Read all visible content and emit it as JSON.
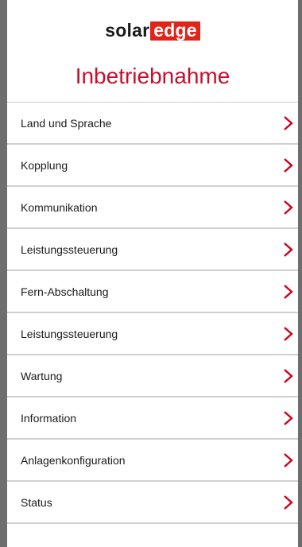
{
  "header": {
    "logo_part1": "solar",
    "logo_part2": "edge",
    "title": "Inbetriebnahme"
  },
  "colors": {
    "accent": "#c8102e",
    "logo_red": "#e2231a",
    "frame": "#6e6e6e"
  },
  "menu": {
    "items": [
      {
        "label": "Land und Sprache",
        "icon": "chevron-right-icon"
      },
      {
        "label": "Kopplung",
        "icon": "chevron-right-icon"
      },
      {
        "label": "Kommunikation",
        "icon": "chevron-right-icon"
      },
      {
        "label": "Leistungssteuerung",
        "icon": "chevron-right-icon"
      },
      {
        "label": "Fern-Abschaltung",
        "icon": "chevron-right-icon"
      },
      {
        "label": "Leistungssteuerung",
        "icon": "chevron-right-icon"
      },
      {
        "label": "Wartung",
        "icon": "chevron-right-icon"
      },
      {
        "label": "Information",
        "icon": "chevron-right-icon"
      },
      {
        "label": "Anlagenkonfiguration",
        "icon": "chevron-right-icon"
      },
      {
        "label": "Status",
        "icon": "chevron-right-icon"
      }
    ]
  }
}
